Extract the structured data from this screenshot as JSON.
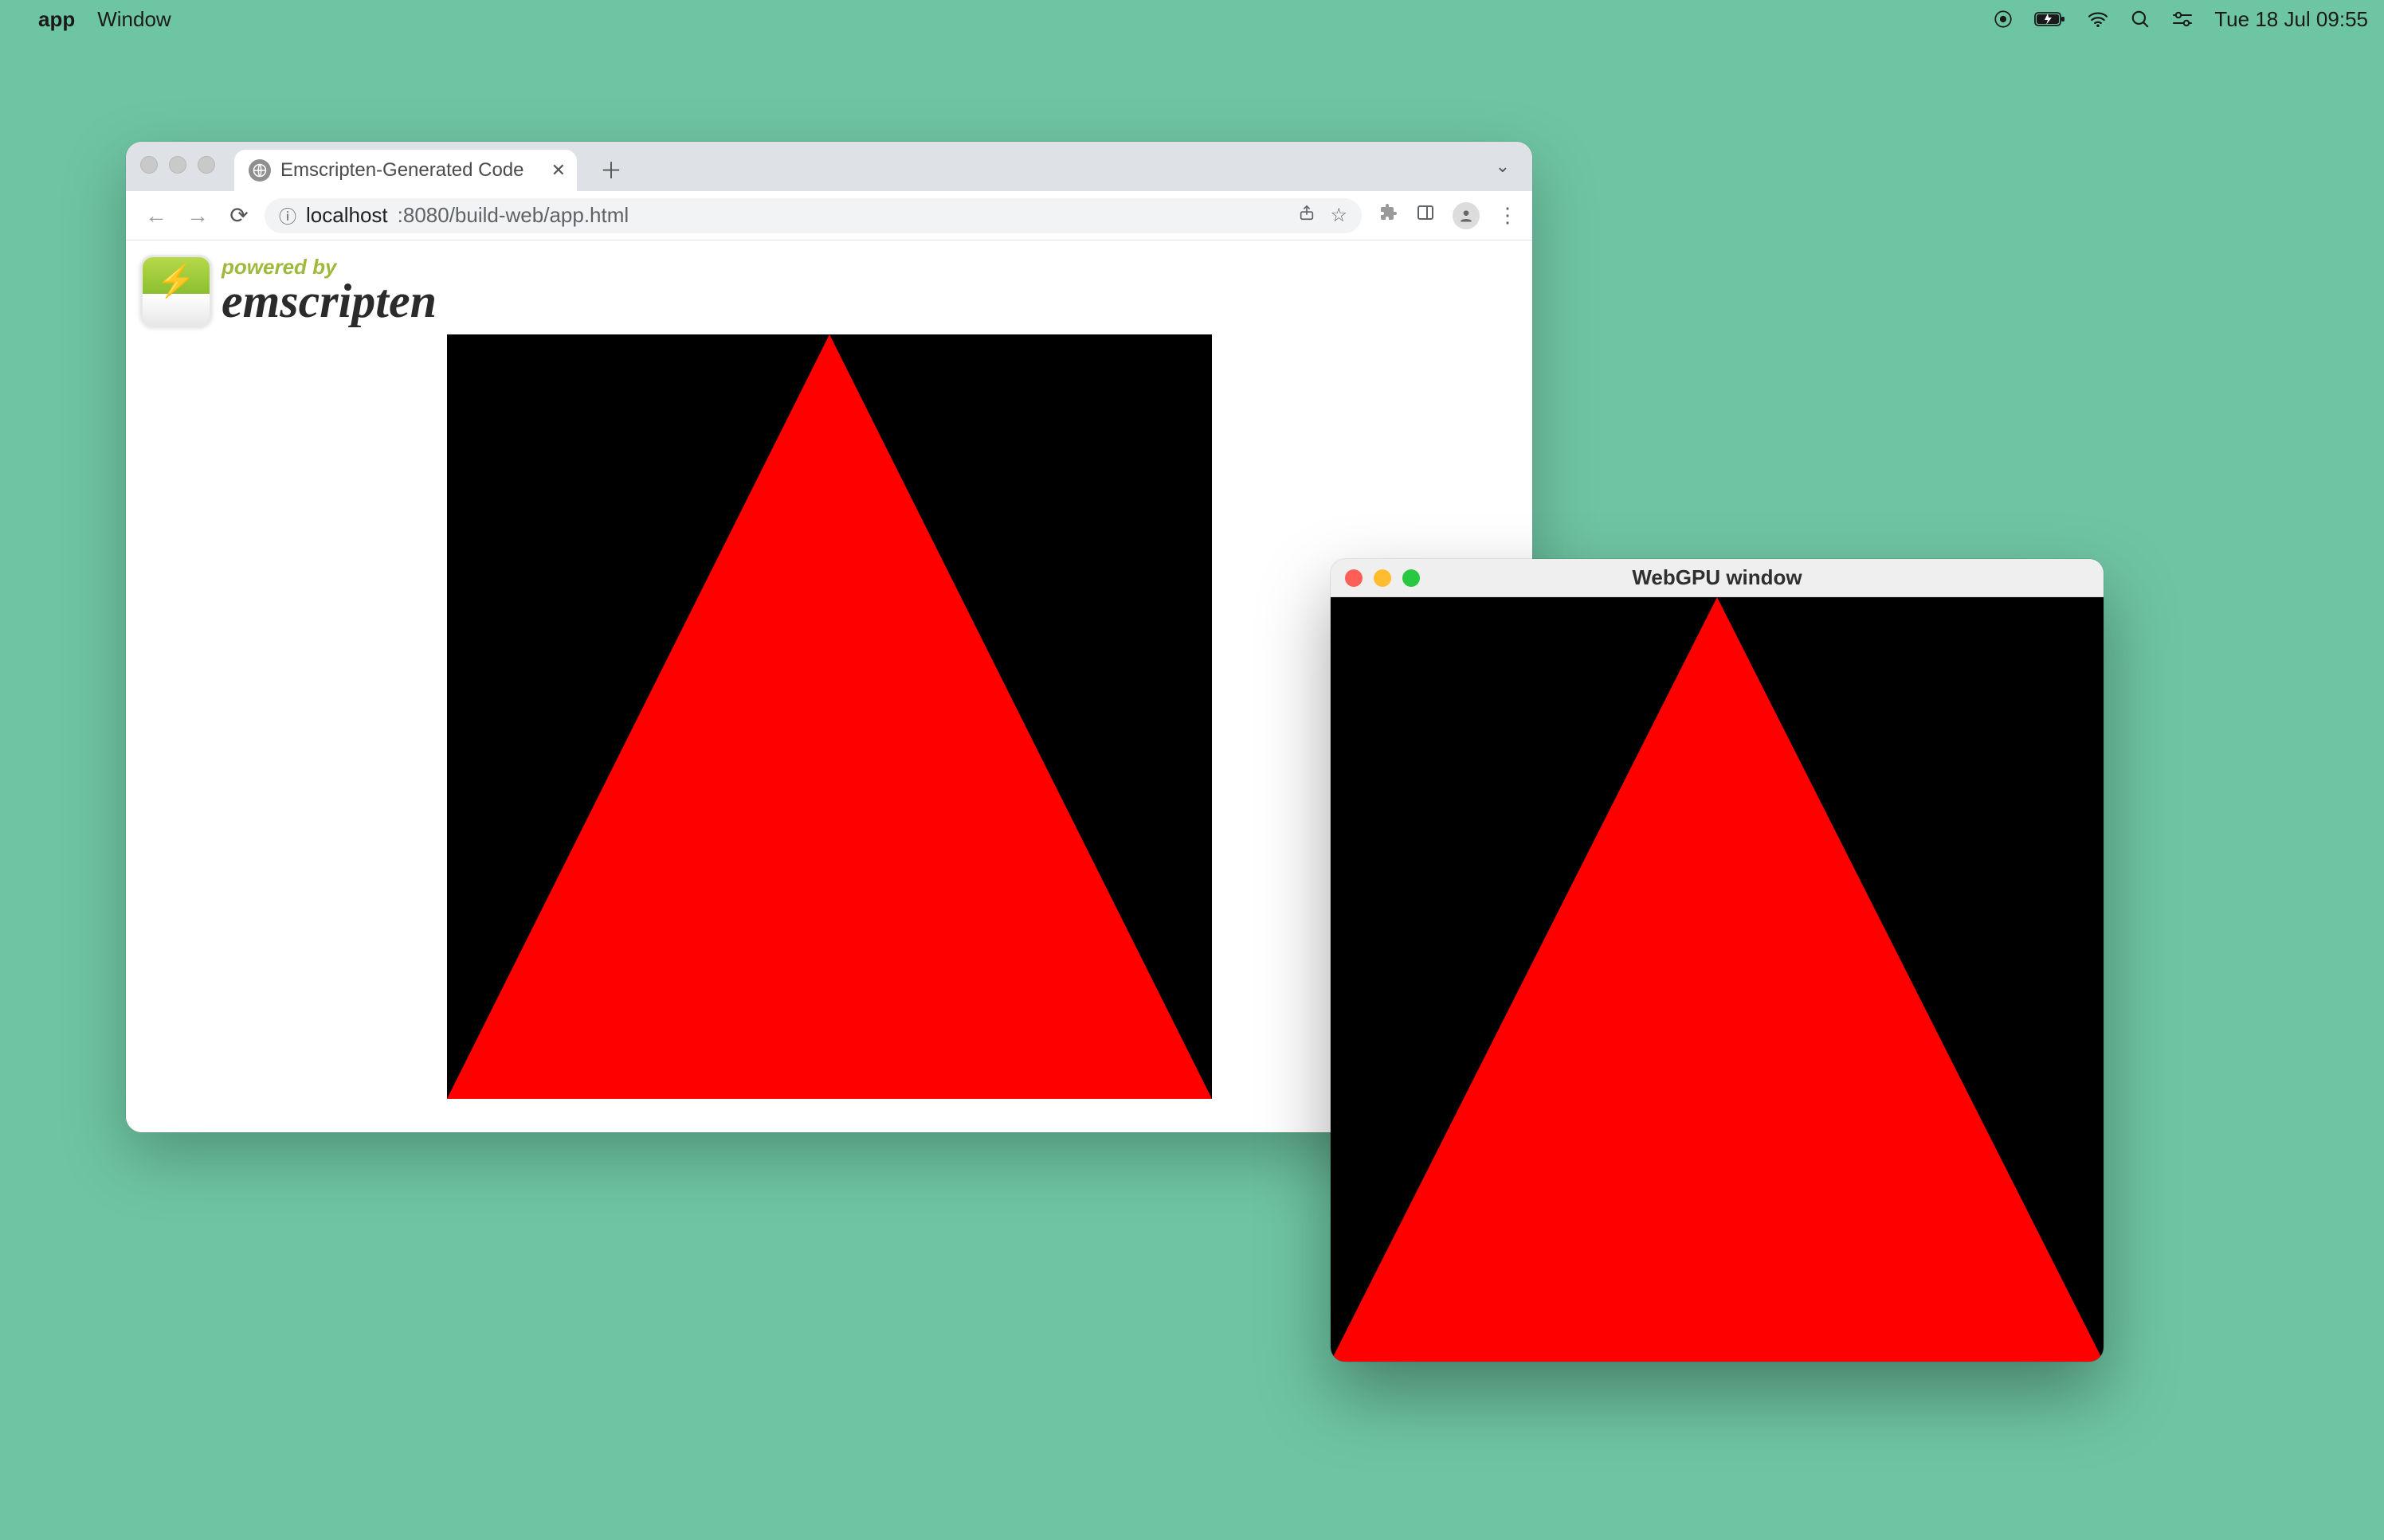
{
  "menubar": {
    "app_name": "app",
    "menu_window": "Window",
    "clock": "Tue 18 Jul  09:55"
  },
  "browser": {
    "tab_title": "Emscripten-Generated Code",
    "url_host": "localhost",
    "url_port_path": ":8080/build-web/app.html",
    "logo_powered": "powered by",
    "logo_name": "emscripten"
  },
  "native_window": {
    "title": "WebGPU window"
  }
}
